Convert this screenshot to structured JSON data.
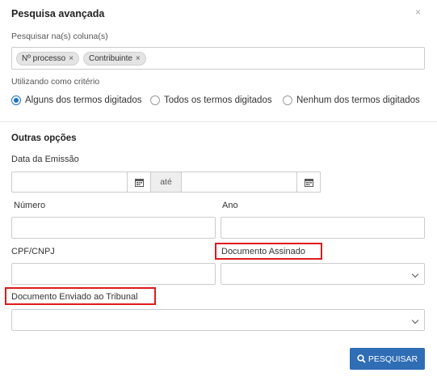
{
  "modal": {
    "title": "Pesquisa avançada",
    "close_label": "×"
  },
  "search": {
    "columns_label": "Pesquisar na(s) coluna(s)",
    "tags": [
      "Nº processo",
      "Contribuinte"
    ],
    "tag_remove": "×",
    "criteria_label": "Utilizando como critério",
    "criteria_options": [
      "Alguns dos termos digitados",
      "Todos os termos digitados",
      "Nenhum dos termos digitados"
    ],
    "criteria_selected": 0
  },
  "options": {
    "section_title": "Outras opções",
    "data_emissao_label": "Data da Emissão",
    "ate_label": "até",
    "numero_label": "Número",
    "ano_label": "Ano",
    "cpf_label": "CPF/CNPJ",
    "doc_assinado_label": "Documento Assinado",
    "doc_enviado_label": "Documento Enviado ao Tribunal"
  },
  "actions": {
    "search_button": "PESQUISAR"
  },
  "colors": {
    "primary": "#2f6db5",
    "highlight": "#e01b1b",
    "radio_selected": "#1a73c8"
  }
}
